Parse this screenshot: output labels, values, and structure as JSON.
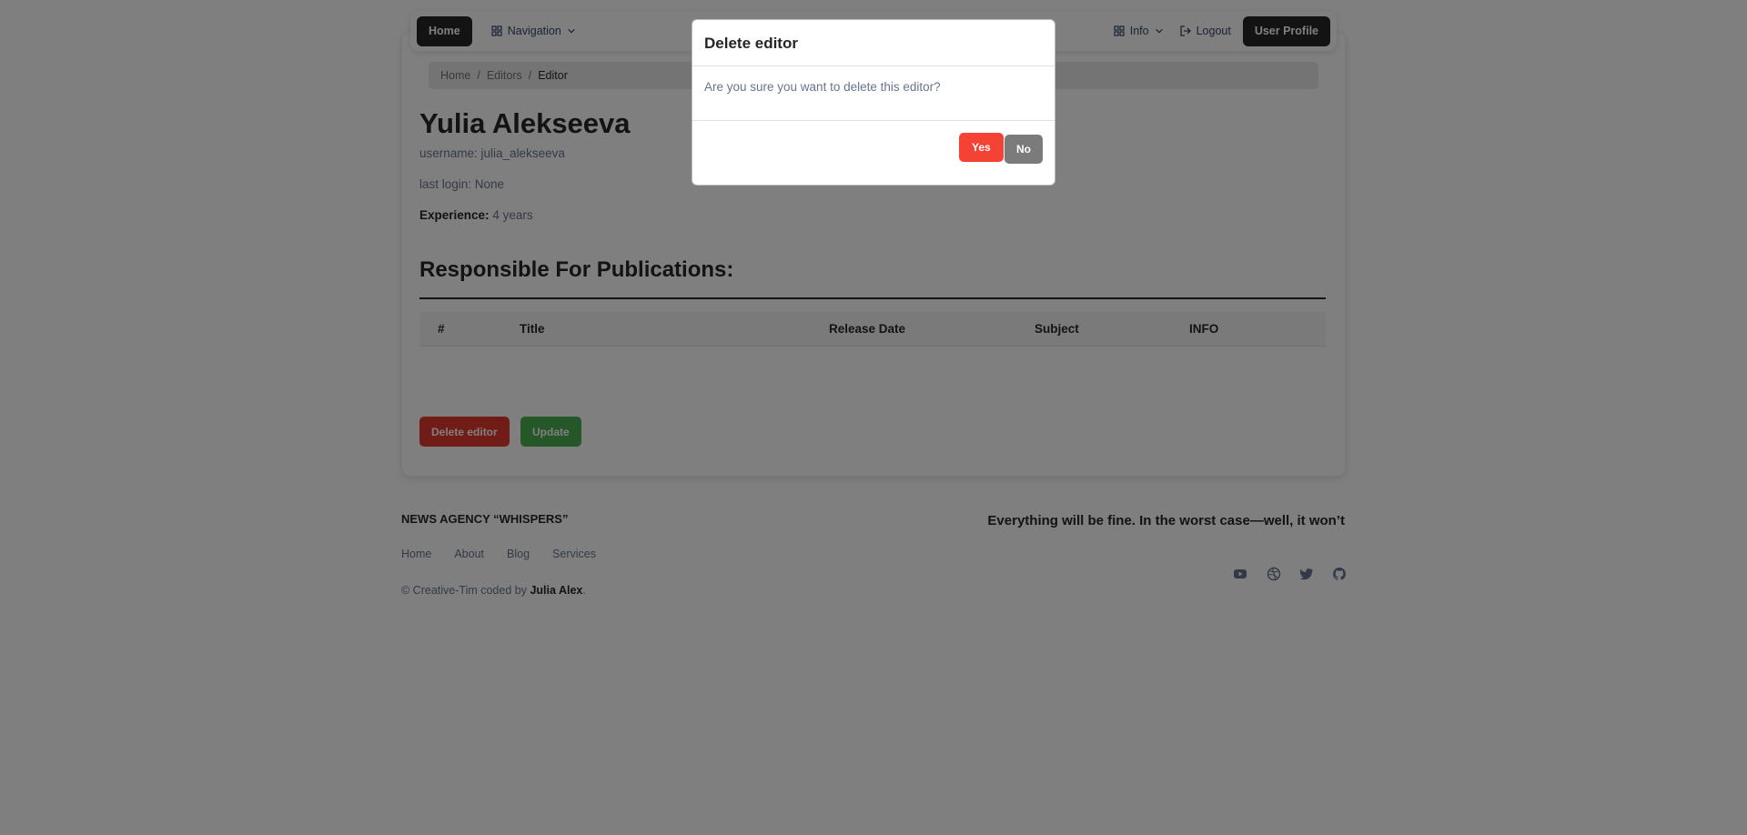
{
  "navbar": {
    "home_label": "Home",
    "navigation_label": "Navigation",
    "info_label": "Info",
    "logout_label": "Logout",
    "user_profile_label": "User Profile"
  },
  "breadcrumb": {
    "items": [
      "Home",
      "Editors",
      "Editor"
    ]
  },
  "editor": {
    "name": "Yulia Alekseeva",
    "username": "username: julia_alekseeva",
    "last_login": "last login: None",
    "experience_label": "Experience:",
    "experience_value": "4 years"
  },
  "publications": {
    "section_title": "Responsible For Publications:",
    "columns": [
      "#",
      "Title",
      "Release Date",
      "Subject",
      "INFO"
    ],
    "rows": []
  },
  "actions": {
    "delete_label": "Delete editor",
    "update_label": "Update"
  },
  "footer": {
    "brand": "NEWS AGENCY “WHISPERS”",
    "tagline": "Everything will be fine. In the worst case—well, it won’t",
    "links": [
      "Home",
      "About",
      "Blog",
      "Services"
    ],
    "copyright_prefix": "© Creative-Tim coded by",
    "copyright_author": "Julia Alex",
    "copyright_suffix": ".",
    "social_icons": [
      "youtube-icon",
      "dribbble-icon",
      "twitter-icon",
      "github-icon"
    ]
  },
  "modal": {
    "title": "Delete editor",
    "body": "Are you sure you want to delete this editor?",
    "yes_label": "Yes",
    "no_label": "No"
  },
  "colors": {
    "danger": "#e5392f",
    "success": "#4caf50",
    "dark": "#262626",
    "secondary": "#7b7b7b"
  }
}
